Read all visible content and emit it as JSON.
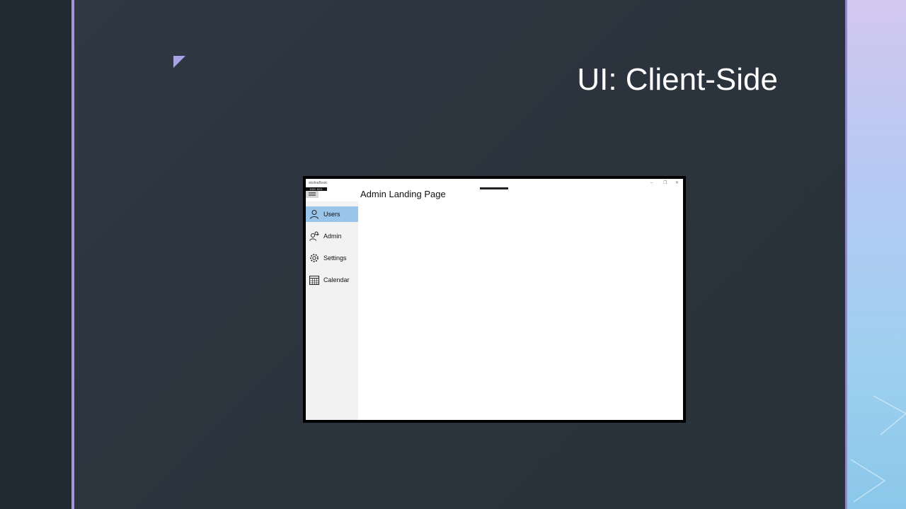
{
  "slide": {
    "title": "UI: Client-Side"
  },
  "window": {
    "app_name": "skolnaBook",
    "counter": "000 001",
    "controls": {
      "minimize": "–",
      "maximize": "❐",
      "close": "✕"
    }
  },
  "sidebar": {
    "items": [
      {
        "label": "Users",
        "icon": "user-icon",
        "selected": true
      },
      {
        "label": "Admin",
        "icon": "admin-icon",
        "selected": false
      },
      {
        "label": "Settings",
        "icon": "gear-icon",
        "selected": false
      },
      {
        "label": "Calendar",
        "icon": "calendar-icon",
        "selected": false
      }
    ]
  },
  "main": {
    "title": "Admin Landing Page"
  },
  "colors": {
    "background": "#2c3540",
    "accent": "#9f97d8",
    "selected_item": "#99c5ea",
    "pane": "#f2f2f2"
  }
}
